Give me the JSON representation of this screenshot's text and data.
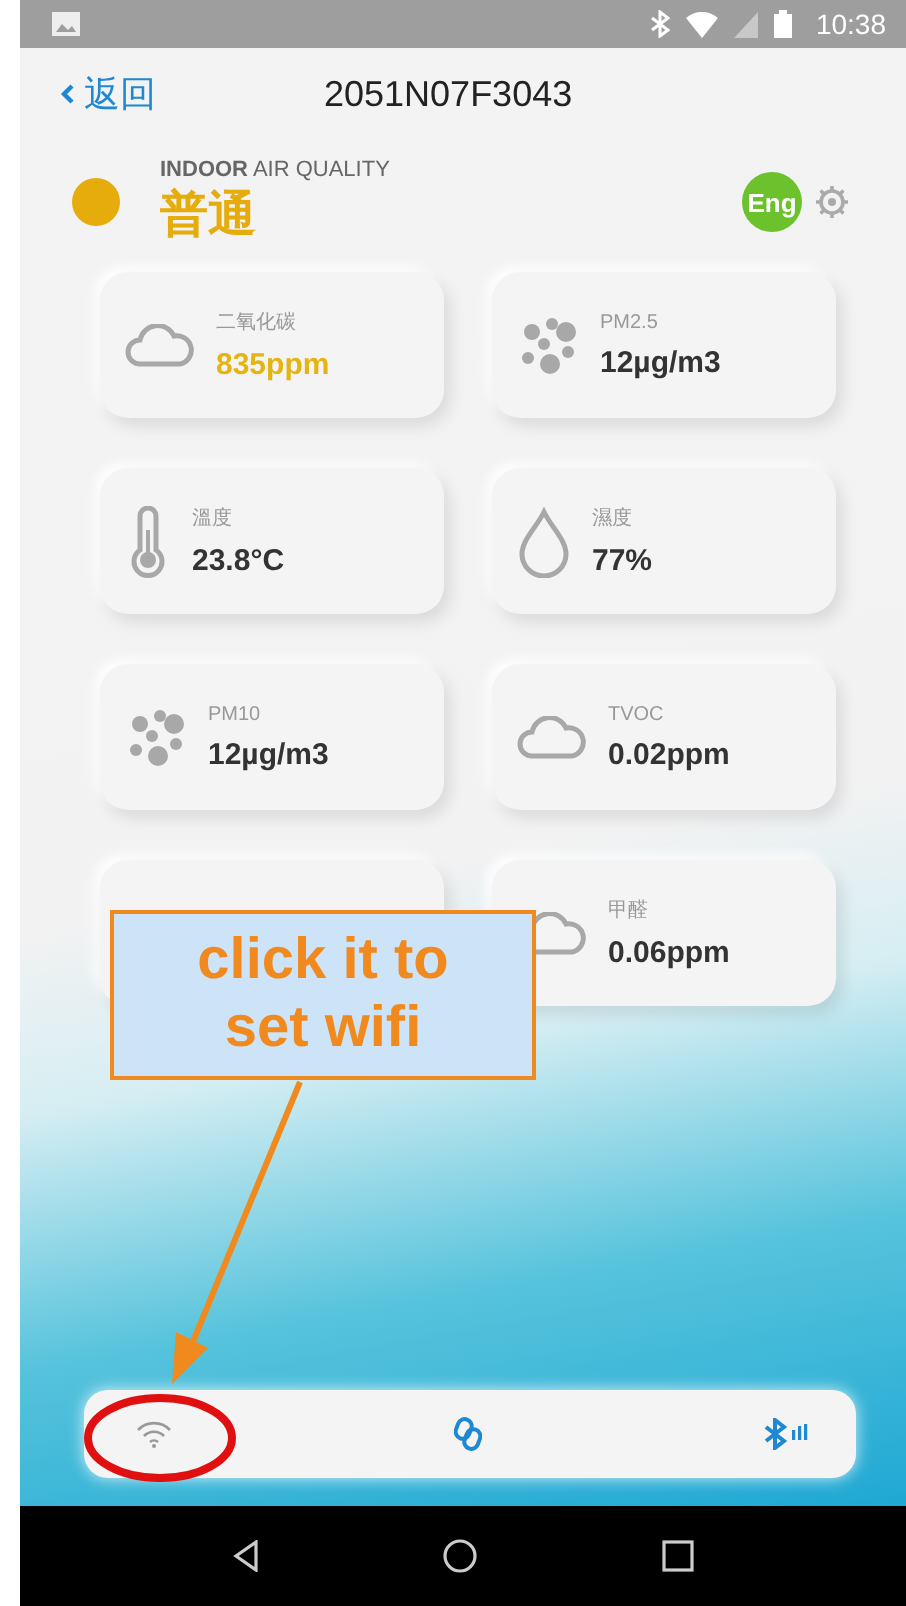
{
  "status_bar": {
    "time": "10:38"
  },
  "header": {
    "back": "返回",
    "title": "2051N07F3043"
  },
  "air_quality": {
    "label": "**INDOOR** AIR QUALITY",
    "status": "普通",
    "color": "#e6ac0c"
  },
  "language": "Eng",
  "metrics": [
    {
      "kind": "cloud",
      "label": "二氧化碳",
      "value": "835ppm",
      "color": "#e6b412"
    },
    {
      "kind": "particles",
      "label": "PM2.5",
      "value": "12µg/m3",
      "color": "#333333"
    },
    {
      "kind": "thermometer",
      "label": "溫度",
      "value": "23.8°C",
      "color": "#333333"
    },
    {
      "kind": "drop",
      "label": "濕度",
      "value": "77%",
      "color": "#333333"
    },
    {
      "kind": "particles",
      "label": "PM10",
      "value": "12µg/m3",
      "color": "#333333"
    },
    {
      "kind": "cloud",
      "label": "TVOC",
      "value": "0.02ppm",
      "color": "#333333"
    },
    {
      "kind": "hidden"
    },
    {
      "kind": "cloud",
      "label": "甲醛",
      "value": "0.06ppm",
      "color": "#333333"
    }
  ],
  "annotation": {
    "text": "click it to set wifi"
  }
}
